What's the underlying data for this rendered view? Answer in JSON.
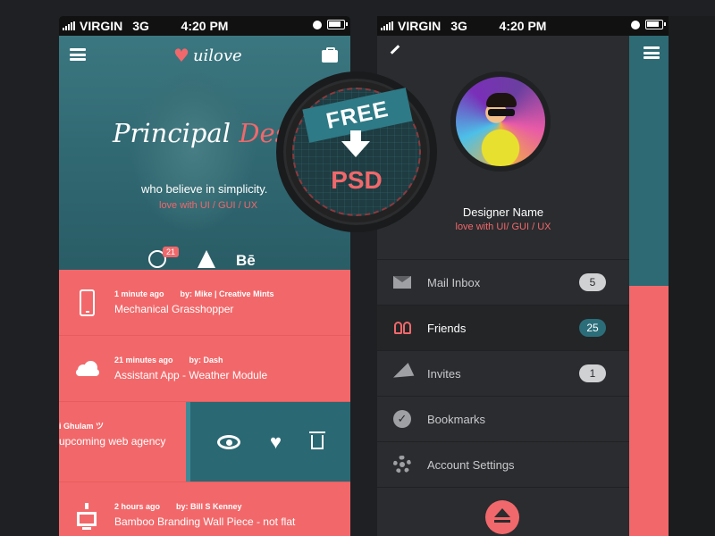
{
  "status_bar": {
    "carrier": "VIRGIN",
    "network": "3G",
    "time": "4:20 PM"
  },
  "phone1": {
    "logo_text": "uilove",
    "hero": {
      "title_main": "Principal",
      "title_accent": "Design",
      "subtitle": "who believe in simplicity.",
      "tagline": "love with UI / GUI / UX"
    },
    "social": {
      "dribbble_count": "21",
      "behance_label": "Bē"
    },
    "feed": [
      {
        "time": "1 minute ago",
        "by": "by: Mike | Creative Mints",
        "title": "Mechanical Grasshopper",
        "icon": "smartphone-icon"
      },
      {
        "time": "21 minutes ago",
        "by": "by: Dash",
        "title": "Assistant App - Weather Module",
        "icon": "cloud-sun-icon"
      }
    ],
    "swipe_item": {
      "by": "i Ghulam ツ",
      "title": "upcoming web agency"
    },
    "feed_last": {
      "time": "2 hours ago",
      "by": "by: Bill S Kenney",
      "title": "Bamboo Branding Wall Piece - not flat",
      "icon": "monitor-icon"
    }
  },
  "badge": {
    "ribbon": "FREE",
    "label": "PSD"
  },
  "phone2": {
    "profile": {
      "name": "Designer Name",
      "tagline": "love with UI/ GUI / UX"
    },
    "menu": [
      {
        "label": "Mail Inbox",
        "count": "5",
        "icon": "mail-icon"
      },
      {
        "label": "Friends",
        "count": "25",
        "icon": "friends-icon"
      },
      {
        "label": "Invites",
        "count": "1",
        "icon": "paper-plane-icon"
      },
      {
        "label": "Bookmarks",
        "count": "",
        "icon": "check-badge-icon"
      },
      {
        "label": "Account Settings",
        "count": "",
        "icon": "gear-icon"
      }
    ]
  },
  "colors": {
    "accent": "#f0686b",
    "teal": "#2d6a74",
    "drawer": "#2a2c2f"
  }
}
